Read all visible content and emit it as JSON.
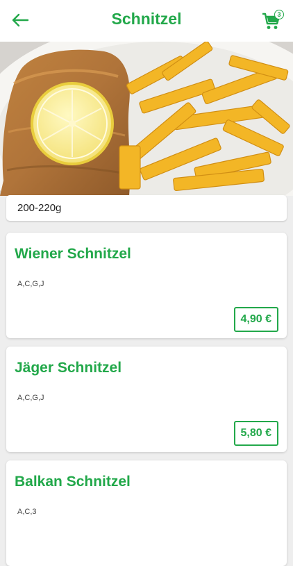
{
  "header": {
    "title": "Schnitzel",
    "back_icon": "arrow-left-icon",
    "cart_icon": "shopping-cart-icon",
    "cart_count": "3"
  },
  "hero": {
    "weight": "200-220g"
  },
  "items": [
    {
      "name": "Wiener Schnitzel",
      "allergens": "A,C,G,J",
      "price": "4,90 €"
    },
    {
      "name": "Jäger Schnitzel",
      "allergens": "A,C,G,J",
      "price": "5,80 €"
    },
    {
      "name": "Balkan Schnitzel",
      "allergens": "A,C,3",
      "price": ""
    }
  ],
  "colors": {
    "accent": "#22a84a",
    "background": "#eeeeee",
    "card": "#ffffff"
  }
}
